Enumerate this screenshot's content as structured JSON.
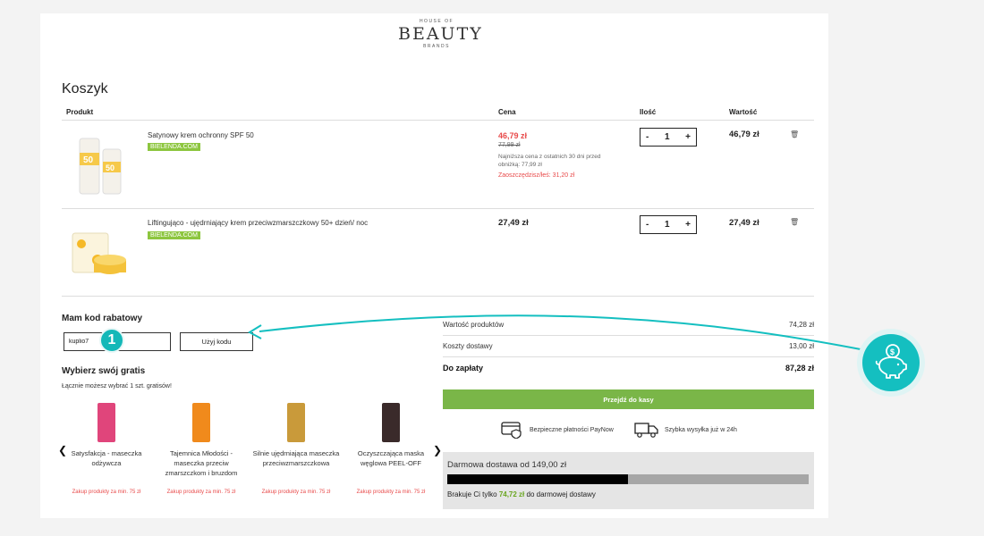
{
  "logo": {
    "line1": "HOUSE OF",
    "line2": "BEAUTY",
    "line3": "BRANDS"
  },
  "cart": {
    "title": "Koszyk",
    "headers": {
      "product": "Produkt",
      "price": "Cena",
      "qty": "Ilość",
      "value": "Wartość"
    },
    "items": [
      {
        "name": "Satynowy krem ochronny SPF 50",
        "brand": "BIELENDA.COM",
        "price_new": "46,79 zł",
        "price_old": "77,99 zł",
        "price_note": "Najniższa cena z ostatnich 30 dni przed obniżką: 77,99 zł",
        "price_save": "Zaoszczędzisz/łeś: 31,20 zł",
        "qty": "1",
        "total": "46,79 zł"
      },
      {
        "name": "Liftingująco - ujędrniający krem przeciwzmarszczkowy 50+ dzień/ noc",
        "brand": "BIELENDA.COM",
        "price": "27,49 zł",
        "qty": "1",
        "total": "27,49 zł"
      }
    ],
    "minus": "-",
    "plus": "+",
    "trash_icon": "🗑"
  },
  "coupon": {
    "title": "Mam kod rabatowy",
    "value": "kuplio7",
    "button": "Użyj kodu",
    "step": "1"
  },
  "gifts": {
    "title": "Wybierz swój gratis",
    "subtitle": "Łącznie możesz wybrać 1 szt. gratisów!",
    "items": [
      {
        "name": "Satysfakcja - maseczka odżywcza",
        "note": "Zakup produkty za min. 75 zł",
        "color": "#e0457b"
      },
      {
        "name": "Tajemnica Młodości - maseczka przeciw zmarszczkom i bruzdom",
        "note": "Zakup produkty za min. 75 zł",
        "color": "#f08a1c"
      },
      {
        "name": "Silnie ujędrniająca maseczka przeciwzmarszczkowa",
        "note": "Zakup produkty za min. 75 zł",
        "color": "#c99a3a"
      },
      {
        "name": "Oczyszczająca maska węglowa PEEL-OFF",
        "note": "Zakup produkty za min. 75 zł",
        "color": "#3a2a2a"
      }
    ],
    "prev": "❮",
    "next": "❯"
  },
  "summary": {
    "products_label": "Wartość produktów",
    "products_value": "74,28 zł",
    "shipping_label": "Koszty dostawy",
    "shipping_value": "13,00 zł",
    "total_label": "Do zapłaty",
    "total_value": "87,28 zł",
    "checkout": "Przejdź do kasy",
    "feature1": "Bezpieczne płatności PayNow",
    "feature2": "Szybka wysyłka już w 24h"
  },
  "free_shipping": {
    "title": "Darmowa dostawa od 149,00 zł",
    "progress": 0.5,
    "text_before": "Brakuje Ci tylko",
    "amount": "74,72 zł",
    "text_after": "do darmowej dostawy"
  },
  "colors": {
    "accent": "#14bfc0",
    "green": "#7ab648",
    "sale": "#e84a4a"
  }
}
